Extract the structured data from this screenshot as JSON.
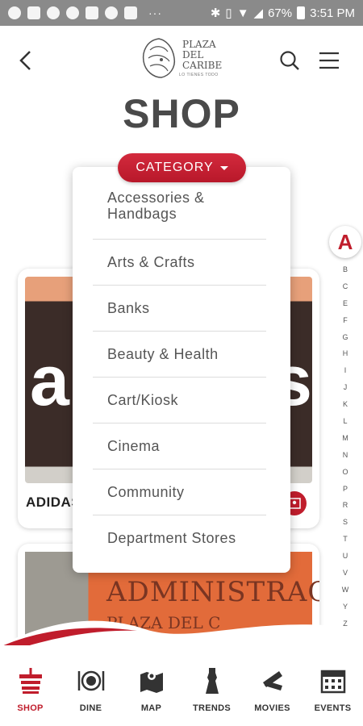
{
  "status_bar": {
    "battery": "67%",
    "time": "3:51 PM",
    "dots": "···"
  },
  "header": {
    "logo_lines": [
      "PLAZA",
      "DEL",
      "CARIBE"
    ],
    "logo_tagline": "LO TIENES TODO"
  },
  "page": {
    "title": "SHOP"
  },
  "category": {
    "label": "CATEGORY",
    "items": [
      "Accessories & Handbags",
      "Arts & Crafts",
      "Banks",
      "Beauty & Health",
      "Cart/Kiosk",
      "Cinema",
      "Community",
      "Department Stores"
    ]
  },
  "cards": [
    {
      "name": "ADIDAS",
      "image_text": [
        "a",
        "s"
      ]
    },
    {
      "image_text": "ADMINISTRACION",
      "image_subtext": "PLAZA DEL C"
    }
  ],
  "alphabet": {
    "current": "A",
    "letters": [
      "B",
      "C",
      "E",
      "F",
      "G",
      "H",
      "I",
      "J",
      "K",
      "L",
      "M",
      "N",
      "O",
      "P",
      "R",
      "S",
      "T",
      "U",
      "V",
      "W",
      "Y",
      "Z"
    ]
  },
  "bottom_nav": [
    {
      "label": "SHOP",
      "icon": "shopping-basket-icon",
      "active": true
    },
    {
      "label": "DINE",
      "icon": "plate-cutlery-icon",
      "active": false
    },
    {
      "label": "MAP",
      "icon": "map-icon",
      "active": false
    },
    {
      "label": "TRENDS",
      "icon": "dress-icon",
      "active": false
    },
    {
      "label": "MOVIES",
      "icon": "clapperboard-icon",
      "active": false
    },
    {
      "label": "EVENTS",
      "icon": "calendar-icon",
      "active": false
    }
  ],
  "colors": {
    "accent": "#c01d2c",
    "title": "#4a4a4a",
    "status_bar": "#8a8a8a"
  }
}
